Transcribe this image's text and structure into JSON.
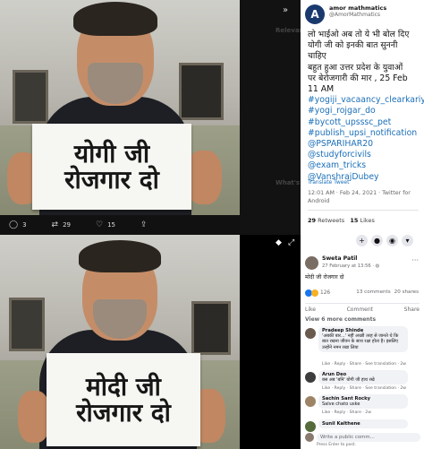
{
  "top_photo": {
    "sign_line1": "योगी जी",
    "sign_line2": "रोजगार दो"
  },
  "bottom_photo": {
    "sign_line1": "मोदी जी",
    "sign_line2": "रोजगार दो"
  },
  "twitter_bar": {
    "replies": "3",
    "retweets": "29",
    "likes": "15"
  },
  "sidebar_strip": {
    "label1": "Relevant",
    "label2": "What's"
  },
  "tweet": {
    "avatar_letter": "A",
    "name": "amor mathmatics",
    "handle": "@AmorMathmatics",
    "body_lines": [
      "लो भाईओ अब तो ये भी बोल दिए",
      "योगी जी को इनकी बात सुननी",
      "चाहिए",
      "बहुत हुआ उत्तर प्रदेश के युवाओं",
      "पर बेरोजगारी की मार , 25 Feb",
      "11 AM"
    ],
    "hashtags": [
      "#yogiji_vacaancy_clearkariye",
      "#yogi_rojgar_do",
      "#bycott_upsssc_pet",
      "#publish_upsi_notification",
      "@PSPARIHAR20",
      "@studyforcivils",
      "@exam_tricks",
      "@VanshrajDubey"
    ],
    "translate": "Translate Tweet",
    "meta": "12:01 AM · Feb 24, 2021 · Twitter for Android",
    "retweets_count": "29",
    "retweets_label": "Retweets",
    "likes_count": "15",
    "likes_label": "Likes"
  },
  "facebook": {
    "top_buttons": [
      "+",
      "●",
      "◉",
      "▾"
    ],
    "author": "Sweta Patil",
    "date": "27 February at 13:56 · ◍",
    "post_text": "मोदी जी रोजगार दो",
    "reaction_count": "126",
    "comments_count": "13 comments",
    "shares_count": "20 shares",
    "actions": [
      "Like",
      "Comment",
      "Share"
    ],
    "view_more": "View 6 more comments",
    "comments": [
      {
        "name": "Pradeep Shinde",
        "text": "'अबकी बार...' नहीं अच्छी तरह से जानते थे कि बात रखना जीवन के साथ रक्षा होता है। इसलिए उन्होंने नमन रखा लिया",
        "links": "Like · Reply · Share · See translation · 2w"
      },
      {
        "name": "Arun Deo",
        "text": "बस अब 'बनि' योगी जी हाथ रखे",
        "links": "Like · Reply · Share · See translation · 2w"
      },
      {
        "name": "Sachin Sant Rocky",
        "text": "Salve chato uske",
        "links": "Like · Reply · Share · 2w"
      },
      {
        "name": "Sunil Kalthene",
        "text": "",
        "links": ""
      }
    ],
    "write_placeholder": "Write a public comm...",
    "press_enter": "Press Enter to post."
  }
}
